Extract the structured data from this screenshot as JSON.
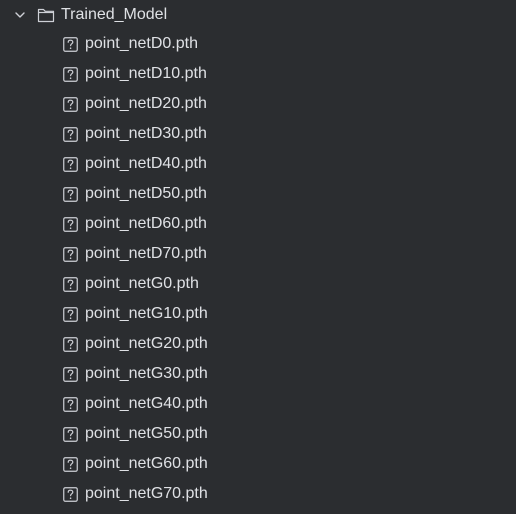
{
  "folder": {
    "name": "Trained_Model",
    "expanded": true,
    "icon": "folder-icon",
    "chevron_icon": "chevron-down-icon"
  },
  "files": [
    {
      "name": "point_netD0.pth",
      "icon": "unknown-file-icon"
    },
    {
      "name": "point_netD10.pth",
      "icon": "unknown-file-icon"
    },
    {
      "name": "point_netD20.pth",
      "icon": "unknown-file-icon"
    },
    {
      "name": "point_netD30.pth",
      "icon": "unknown-file-icon"
    },
    {
      "name": "point_netD40.pth",
      "icon": "unknown-file-icon"
    },
    {
      "name": "point_netD50.pth",
      "icon": "unknown-file-icon"
    },
    {
      "name": "point_netD60.pth",
      "icon": "unknown-file-icon"
    },
    {
      "name": "point_netD70.pth",
      "icon": "unknown-file-icon"
    },
    {
      "name": "point_netG0.pth",
      "icon": "unknown-file-icon"
    },
    {
      "name": "point_netG10.pth",
      "icon": "unknown-file-icon"
    },
    {
      "name": "point_netG20.pth",
      "icon": "unknown-file-icon"
    },
    {
      "name": "point_netG30.pth",
      "icon": "unknown-file-icon"
    },
    {
      "name": "point_netG40.pth",
      "icon": "unknown-file-icon"
    },
    {
      "name": "point_netG50.pth",
      "icon": "unknown-file-icon"
    },
    {
      "name": "point_netG60.pth",
      "icon": "unknown-file-icon"
    },
    {
      "name": "point_netG70.pth",
      "icon": "unknown-file-icon"
    }
  ],
  "colors": {
    "background": "#2b2d30",
    "text": "#dfe1e5",
    "icon": "#ced0d6"
  }
}
